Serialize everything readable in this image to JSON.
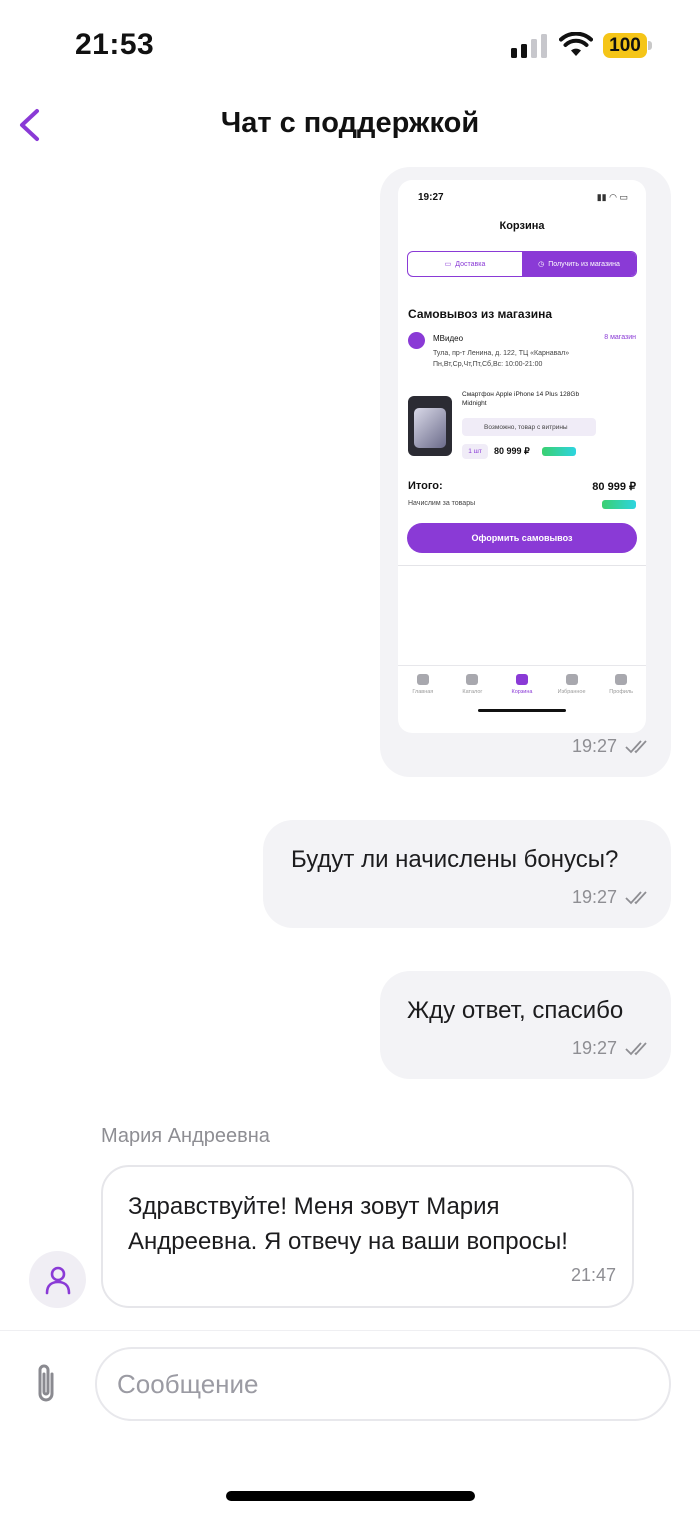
{
  "status_bar": {
    "time": "21:53",
    "battery": "100",
    "battery_color": "#F5C518"
  },
  "header": {
    "title": "Чат с поддержкой",
    "back_icon": "chevron-left-icon"
  },
  "theme": {
    "accent": "#8A3AD6",
    "bubble_bg": "#F3F3F6",
    "meta_text": "#8E8E93"
  },
  "messages": {
    "screenshot_message": {
      "time": "19:27",
      "screenshot": {
        "status_time": "19:27",
        "title": "Корзина",
        "tab_delivery": "Доставка",
        "tab_pickup": "Получить из магазина",
        "heading": "Самовывоз из магазина",
        "store_name": "МВидео",
        "store_count": "8 магазин",
        "store_address": "Тула, пр-т Ленина, д. 122, ТЦ «Карнавал»",
        "store_hours": "Пн,Вт,Ср,Чт,Пт,Сб,Вс: 10:00-21:00",
        "product_name": "Смартфон Apple iPhone 14 Plus 128Gb Midnight",
        "product_note": "Возможно, товар с витрины",
        "qty": "1 шт",
        "price": "80 999 ₽",
        "total_label": "Итого:",
        "total_value": "80 999 ₽",
        "bonus_label": "Начислим за товары",
        "cta": "Оформить самовывоз",
        "nav": [
          "Главная",
          "Каталог",
          "Корзина",
          "Избранное",
          "Профиль"
        ]
      }
    },
    "out_1": {
      "text": "Будут ли начислены бонусы?",
      "time": "19:27"
    },
    "out_2": {
      "text": "Жду ответ, спасибо",
      "time": "19:27"
    },
    "in_1": {
      "sender": "Мария Андреевна",
      "text": "Здравствуйте! Меня зовут Мария Андреевна. Я отвечу на ваши вопросы!",
      "time": "21:47",
      "avatar_icon": "user-icon"
    }
  },
  "composer": {
    "placeholder": "Сообщение",
    "value": "",
    "attach_icon": "paperclip-icon"
  }
}
